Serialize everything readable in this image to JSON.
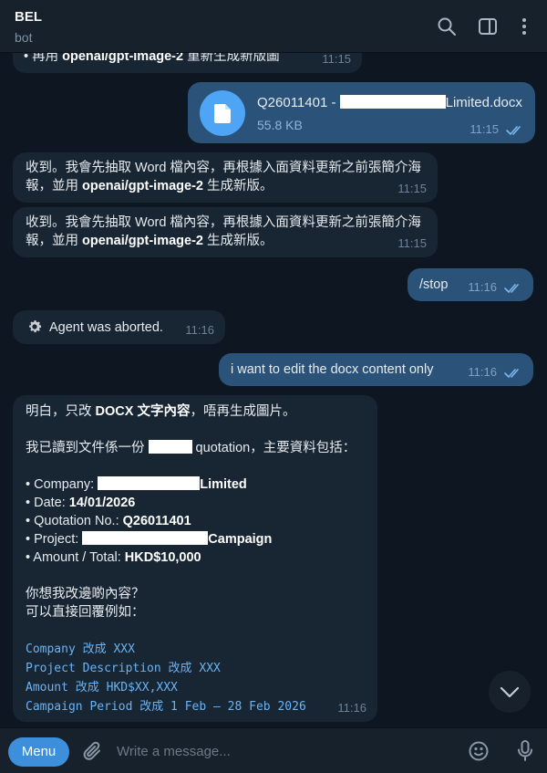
{
  "header": {
    "title": "BEL",
    "subtitle": "bot"
  },
  "messages": {
    "m0": {
      "text_prefix": "• 再用 ",
      "text_bold": "openai/gpt-image-2",
      "text_suffix": " 重新生成新版圖",
      "time": "11:15"
    },
    "file": {
      "name_prefix": "Q26011401 - ",
      "name_suffix": "Limited.docx",
      "size": "55.8 KB",
      "time": "11:15"
    },
    "m2": {
      "line1": "收到。我會先抽取 Word 檔內容，再根據入面資料更新之前張簡介海",
      "line2_prefix": "報，並用 ",
      "line2_bold": "openai/gpt-image-2",
      "line2_suffix": " 生成新版。",
      "time": "11:15"
    },
    "m3": {
      "line1": "收到。我會先抽取 Word 檔內容，再根據入面資料更新之前張簡介海",
      "line2_prefix": "報，並用 ",
      "line2_bold": "openai/gpt-image-2",
      "line2_suffix": " 生成新版。",
      "time": "11:15"
    },
    "m4": {
      "text": "/stop",
      "time": "11:16"
    },
    "m5": {
      "text": "Agent was aborted.",
      "time": "11:16"
    },
    "m6": {
      "text": "i want to edit the docx content only",
      "time": "11:16"
    },
    "m7": {
      "l1_prefix": "明白，只改 ",
      "l1_bold": "DOCX 文字內容",
      "l1_suffix": "，唔再生成圖片。",
      "l2_prefix": "我已讀到文件係一份 ",
      "l2_suffix": " quotation，主要資料包括：",
      "company_label": "• Company: ",
      "company_value": "Limited",
      "date_label": "• Date: ",
      "date_value": "14/01/2026",
      "quote_label": "• Quotation No.: ",
      "quote_value": "Q26011401",
      "project_label": "• Project: ",
      "project_value": "Campaign",
      "amount_label": "• Amount / Total: ",
      "amount_value": "HKD$10,000",
      "q1": "你想我改邊啲內容？",
      "q2": "可以直接回覆例如：",
      "ex1_code": "Company",
      "ex1_rest": " 改成 XXX",
      "ex2_code": "Project Description",
      "ex2_rest": " 改成 XXX",
      "ex3_code": "Amount",
      "ex3_rest": " 改成 HKD$XX,XXX",
      "ex4_code": "Campaign Period",
      "ex4_rest": " 改成 1 Feb – 28 Feb 2026",
      "time": "11:16"
    }
  },
  "composer": {
    "menu_label": "Menu",
    "placeholder": "Write a message..."
  },
  "colors": {
    "background": "#0e1621",
    "incoming": "#182533",
    "outgoing": "#2b5278",
    "accent": "#3d8fdc"
  },
  "icons": [
    "search-icon",
    "sidebar-toggle-icon",
    "more-vertical-icon",
    "file-icon",
    "gear-icon",
    "double-check-icon",
    "chevron-down-icon",
    "paperclip-icon",
    "emoji-icon",
    "microphone-icon"
  ]
}
